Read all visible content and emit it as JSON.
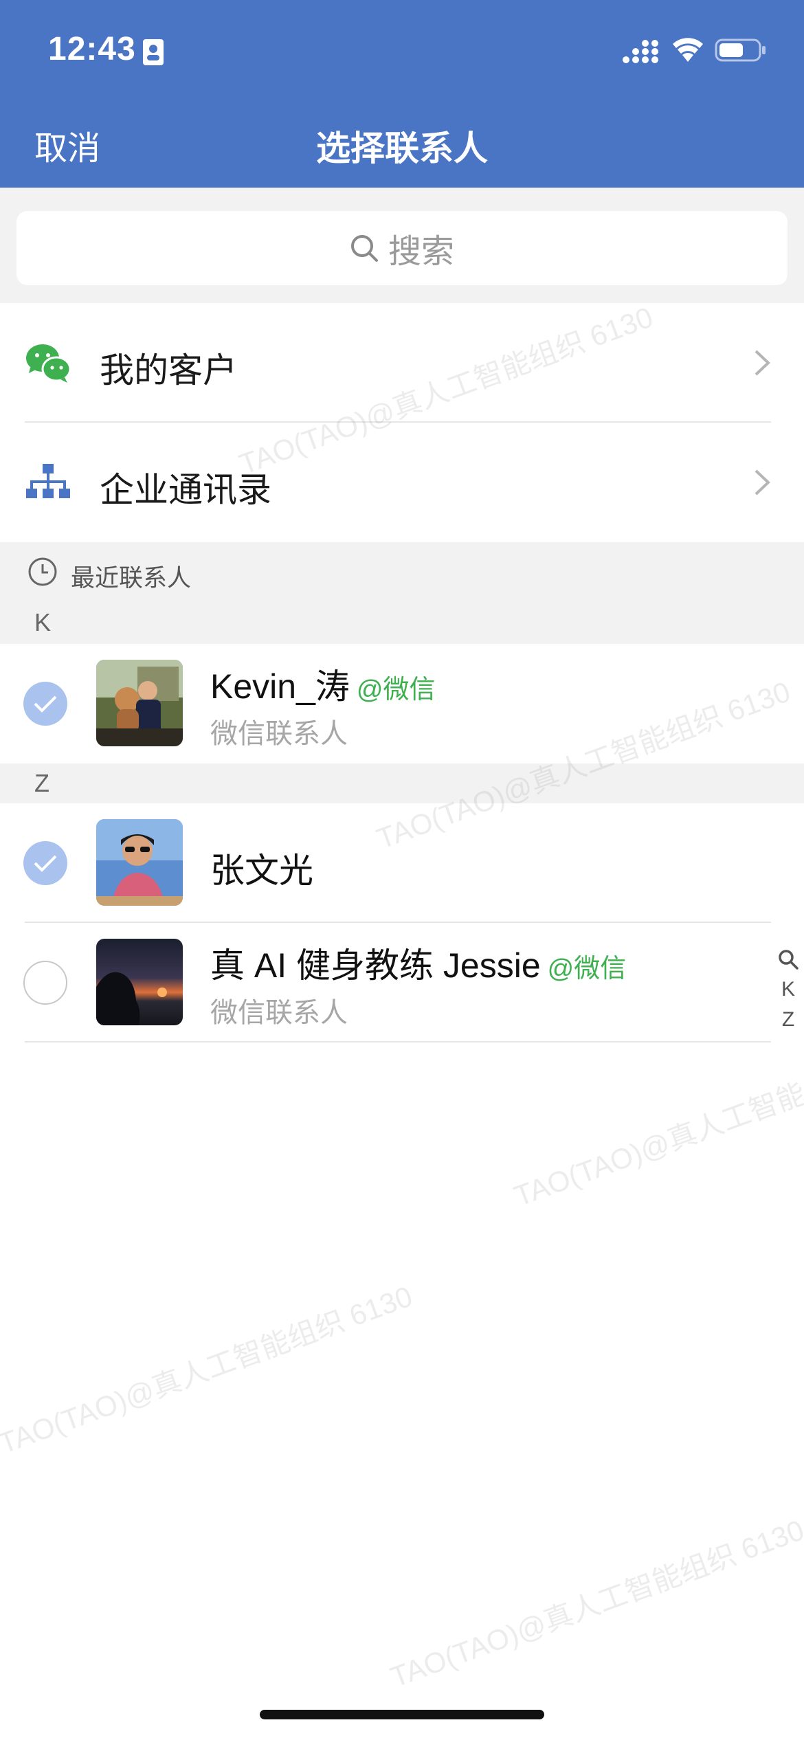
{
  "status_bar": {
    "time": "12:43"
  },
  "header": {
    "cancel_label": "取消",
    "title": "选择联系人"
  },
  "search": {
    "placeholder": "搜索"
  },
  "entries": [
    {
      "label": "我的客户",
      "icon": "wechat-icon"
    },
    {
      "label": "企业通讯录",
      "icon": "org-chart-icon"
    }
  ],
  "recent": {
    "label": "最近联系人"
  },
  "sections": [
    {
      "letter": "K"
    },
    {
      "letter": "Z"
    }
  ],
  "contacts": [
    {
      "name": "Kevin_涛",
      "tag": "@微信",
      "subtitle": "微信联系人",
      "selected": true
    },
    {
      "name": "张文光",
      "tag": "",
      "subtitle": "",
      "selected": true
    },
    {
      "name": "真 AI 健身教练 Jessie",
      "tag": "@微信",
      "subtitle": "微信联系人",
      "selected": false
    }
  ],
  "index_bar": {
    "letters": [
      "K",
      "Z"
    ]
  },
  "watermark": "TAO(TAO)@真人工智能组织 6130",
  "colors": {
    "header_bg": "#4a74c4",
    "wechat_green": "#3eb04f",
    "check_fill": "#a9c3ee",
    "section_bg": "#f2f2f2"
  }
}
